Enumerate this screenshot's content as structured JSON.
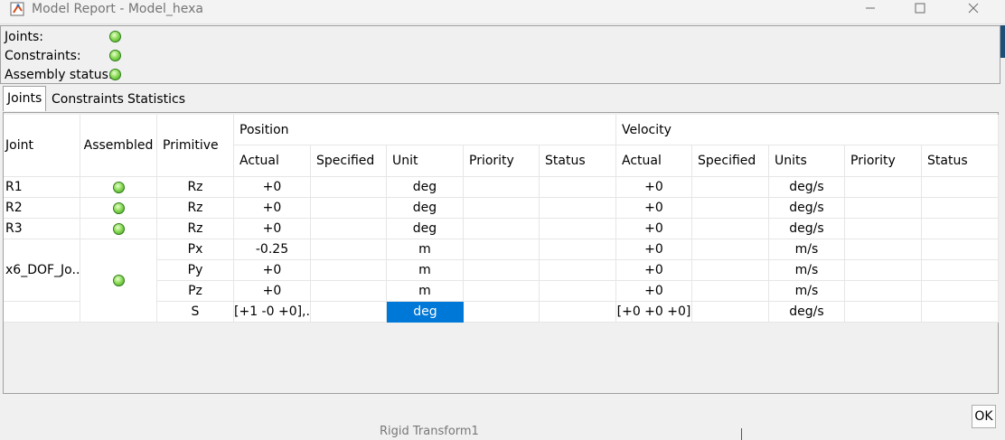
{
  "window": {
    "title": "Model Report - Model_hexa"
  },
  "status": {
    "joints_label": "Joints:",
    "constraints_label": "Constraints:",
    "assembly_label": "Assembly status:",
    "color": "#6cc644"
  },
  "tabs": [
    {
      "label": "Joints"
    },
    {
      "label": "Constraints"
    },
    {
      "label": "Statistics"
    }
  ],
  "table": {
    "headers": {
      "joint": "Joint",
      "assembled": "Assembled",
      "primitive": "Primitive",
      "position": "Position",
      "velocity": "Velocity",
      "pos_actual": "Actual",
      "pos_specified": "Specified",
      "pos_unit": "Unit",
      "pos_priority": "Priority",
      "pos_status": "Status",
      "vel_actual": "Actual",
      "vel_specified": "Specified",
      "vel_units": "Units",
      "vel_priority": "Priority",
      "vel_status": "Status"
    },
    "rows": [
      {
        "joint": "R1",
        "primitive": "Rz",
        "pos_actual": "+0",
        "pos_unit": "deg",
        "vel_actual": "+0",
        "vel_units": "deg/s"
      },
      {
        "joint": "R2",
        "primitive": "Rz",
        "pos_actual": "+0",
        "pos_unit": "deg",
        "vel_actual": "+0",
        "vel_units": "deg/s"
      },
      {
        "joint": "R3",
        "primitive": "Rz",
        "pos_actual": "+0",
        "pos_unit": "deg",
        "vel_actual": "+0",
        "vel_units": "deg/s"
      },
      {
        "joint": "x6_DOF_Jo...",
        "primitive": "Px",
        "pos_actual": "-0.25",
        "pos_unit": "m",
        "vel_actual": "+0",
        "vel_units": "m/s"
      },
      {
        "primitive": "Py",
        "pos_actual": "+0",
        "pos_unit": "m",
        "vel_actual": "+0",
        "vel_units": "m/s"
      },
      {
        "primitive": "Pz",
        "pos_actual": "+0",
        "pos_unit": "m",
        "vel_actual": "+0",
        "vel_units": "m/s"
      },
      {
        "primitive": "S",
        "pos_actual": "[+1 -0 +0],...",
        "pos_unit": "deg",
        "vel_actual": "[+0 +0 +0]",
        "vel_units": "deg/s"
      }
    ]
  },
  "background": {
    "text": "Rigid Transform1"
  },
  "ok_button": "OK"
}
